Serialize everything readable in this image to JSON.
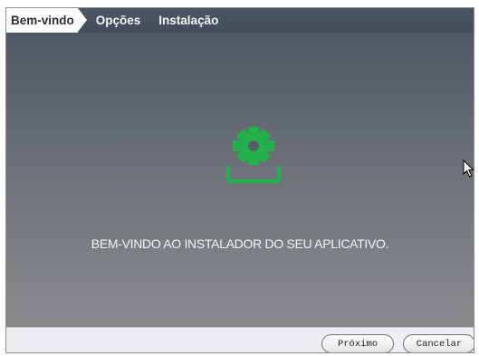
{
  "steps": [
    {
      "label": "Bem-vindo",
      "active": true
    },
    {
      "label": "Opções",
      "active": false
    },
    {
      "label": "Instalação",
      "active": false
    }
  ],
  "main": {
    "icon": "gear-install-icon",
    "welcome_text": "BEM-VINDO AO INSTALADOR DO SEU APLICATIVO."
  },
  "footer": {
    "next_label": "Próximo",
    "cancel_label": "Cancelar"
  },
  "colors": {
    "accent": "#22b24c",
    "header_bg": "#4b5664"
  },
  "pointer": "mouse-cursor-icon"
}
